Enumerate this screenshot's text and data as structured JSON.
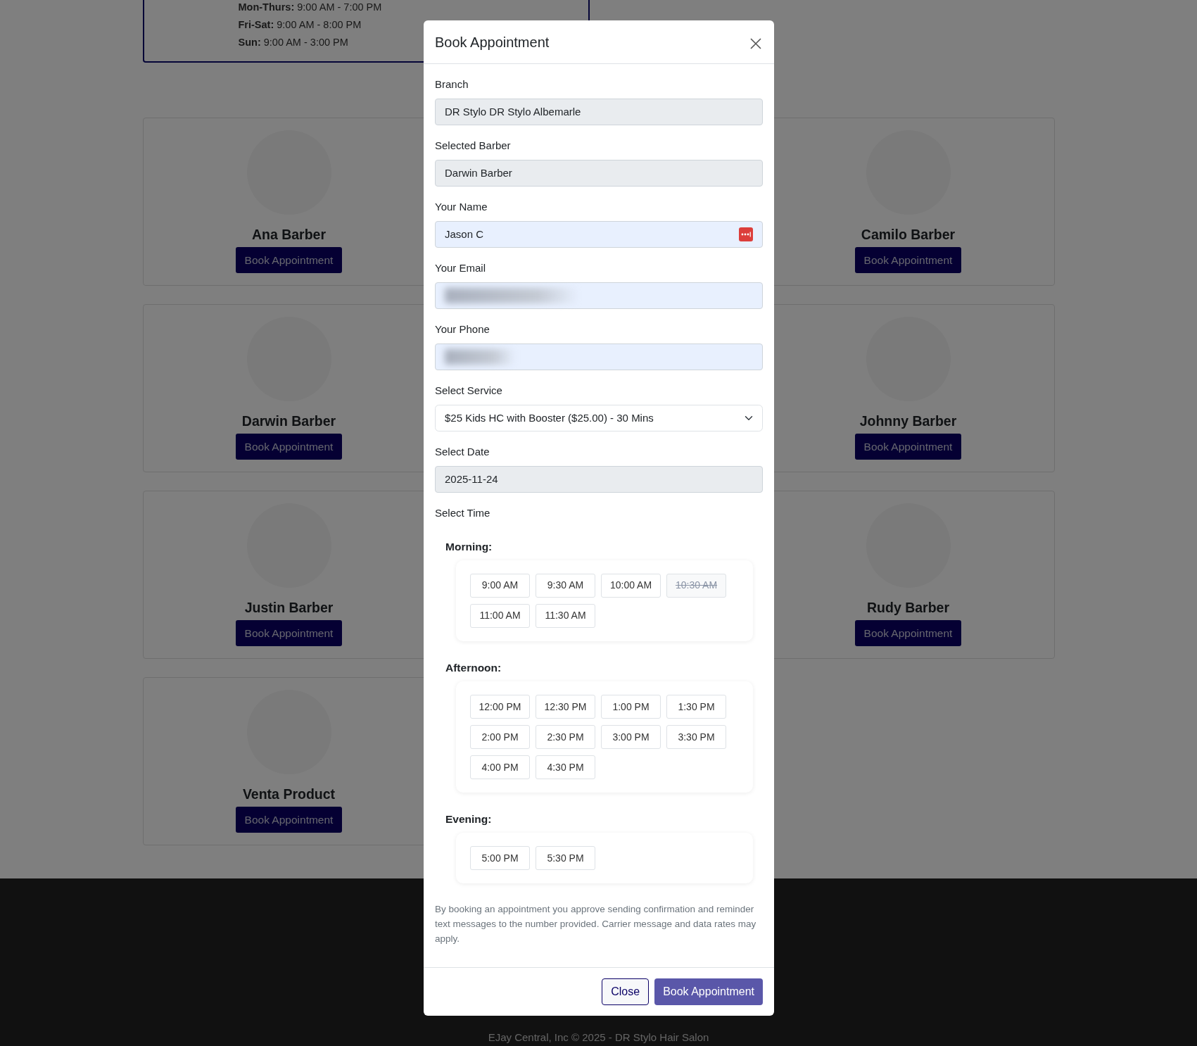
{
  "page": {
    "hours": [
      "**Mon-Thurs:** 9:00 AM - 7:00 PM",
      "**Fri-Sat:** 9:00 AM - 8:00 PM",
      "**Sun:** 9:00 AM - 3:00 PM"
    ],
    "rows": [
      {
        "left": {
          "name": "Ana Barber",
          "button": "Book Appointment"
        },
        "right": {
          "name": "Camilo Barber",
          "button": "Book Appointment"
        }
      },
      {
        "left": {
          "name": "Darwin Barber",
          "button": "Book Appointment"
        },
        "right": {
          "name": "Johnny Barber",
          "button": "Book Appointment"
        }
      },
      {
        "left": {
          "name": "Justin Barber",
          "button": "Book Appointment"
        },
        "right": {
          "name": "Rudy Barber",
          "button": "Book Appointment"
        }
      },
      {
        "left": {
          "name": "Venta Product",
          "button": "Book Appointment"
        }
      }
    ],
    "footer": "EJay Central, Inc © 2025 - DR Stylo Hair Salon"
  },
  "modal": {
    "title": "Book Appointment",
    "fields": [
      {
        "label": "Branch",
        "kind": "readonly",
        "value": "DR Stylo DR Stylo Albemarle"
      },
      {
        "label": "Selected Barber",
        "kind": "readonly",
        "value": "Darwin Barber"
      },
      {
        "label": "Your Name",
        "kind": "autofill",
        "value": "Jason C",
        "manager_icon": true
      },
      {
        "label": "Your Email",
        "kind": "autofill",
        "blurred": true
      },
      {
        "label": "Your Phone",
        "kind": "autofill",
        "blurred": true
      },
      {
        "label": "Select Service",
        "kind": "select",
        "value": "$25 Kids HC with Booster ($25.00) - 30 Mins"
      },
      {
        "label": "Select Date",
        "kind": "readonly",
        "value": "2025-11-24"
      }
    ],
    "time_label": "Select Time",
    "periods": [
      {
        "label": "Morning:",
        "slots": [
          {
            "time": "9:00 AM",
            "disabled": false
          },
          {
            "time": "9:30 AM",
            "disabled": false
          },
          {
            "time": "10:00 AM",
            "disabled": false
          },
          {
            "time": "10:30 AM",
            "disabled": true
          },
          {
            "time": "11:00 AM",
            "disabled": false
          },
          {
            "time": "11:30 AM",
            "disabled": false
          }
        ]
      },
      {
        "label": "Afternoon:",
        "slots": [
          {
            "time": "12:00 PM",
            "disabled": false
          },
          {
            "time": "12:30 PM",
            "disabled": false
          },
          {
            "time": "1:00 PM",
            "disabled": false
          },
          {
            "time": "1:30 PM",
            "disabled": false
          },
          {
            "time": "2:00 PM",
            "disabled": false
          },
          {
            "time": "2:30 PM",
            "disabled": false
          },
          {
            "time": "3:00 PM",
            "disabled": false
          },
          {
            "time": "3:30 PM",
            "disabled": false
          },
          {
            "time": "4:00 PM",
            "disabled": false
          },
          {
            "time": "4:30 PM",
            "disabled": false
          }
        ]
      },
      {
        "label": "Evening:",
        "slots": [
          {
            "time": "5:00 PM",
            "disabled": false
          },
          {
            "time": "5:30 PM",
            "disabled": false
          }
        ]
      }
    ],
    "notice": "By booking an appointment you approve sending confirmation and reminder text messages to the number provided. Carrier message and data rates may apply.",
    "buttons": [
      {
        "label": "Close",
        "kind": "secondary"
      },
      {
        "label": "Book Appointment",
        "kind": "primary"
      }
    ]
  }
}
